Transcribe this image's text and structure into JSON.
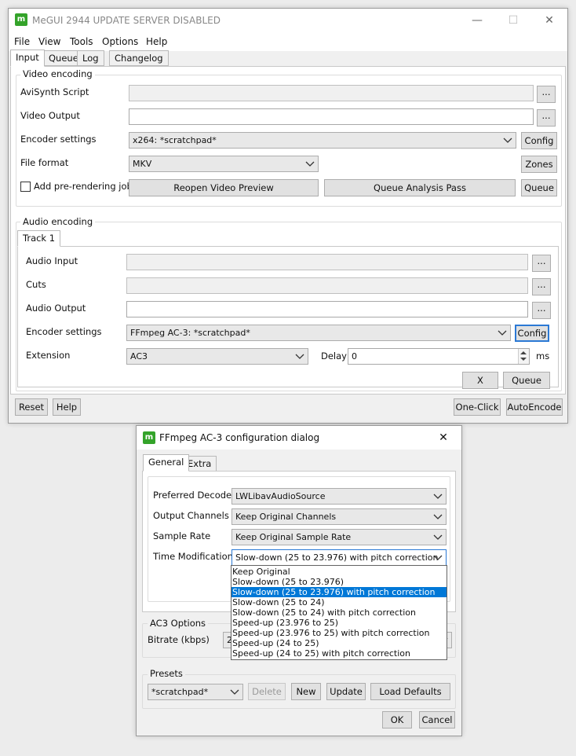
{
  "main_window": {
    "title": "MeGUI 2944 UPDATE SERVER DISABLED",
    "menu": [
      "File",
      "View",
      "Tools",
      "Options",
      "Help"
    ],
    "tabs": [
      "Input",
      "Queue",
      "Log",
      "Changelog"
    ],
    "video": {
      "group_label": "Video encoding",
      "avisynth_label": "AviSynth Script",
      "avisynth_value": "",
      "output_label": "Video Output",
      "output_value": "",
      "encoder_label": "Encoder settings",
      "encoder_value": "x264: *scratchpad*",
      "config_label": "Config",
      "format_label": "File format",
      "format_value": "MKV",
      "zones_label": "Zones",
      "prerender_label": "Add pre-rendering job",
      "reopen_label": "Reopen Video Preview",
      "analysis_label": "Queue Analysis Pass",
      "queue_label": "Queue",
      "browse_label": "..."
    },
    "audio": {
      "group_label": "Audio encoding",
      "track_tab": "Track 1",
      "input_label": "Audio Input",
      "cuts_label": "Cuts",
      "output_label": "Audio Output",
      "encoder_label": "Encoder settings",
      "encoder_value": "FFmpeg AC-3: *scratchpad*",
      "config_label": "Config",
      "extension_label": "Extension",
      "extension_value": "AC3",
      "delay_label": "Delay",
      "delay_value": "0",
      "ms_label": "ms",
      "x_label": "X",
      "queue_label": "Queue",
      "browse_label": "..."
    },
    "bottom": {
      "reset": "Reset",
      "help": "Help",
      "oneclick": "One-Click",
      "autoencode": "AutoEncode"
    }
  },
  "dialog": {
    "title": "FFmpeg AC-3 configuration dialog",
    "tabs": [
      "General",
      "Extra"
    ],
    "decoder_label": "Preferred Decoder",
    "decoder_value": "LWLibavAudioSource",
    "channels_label": "Output Channels",
    "channels_value": "Keep Original Channels",
    "rate_label": "Sample Rate",
    "rate_value": "Keep Original Sample Rate",
    "time_label": "Time Modification",
    "time_value": "Slow-down (25 to 23.976) with pitch correction",
    "time_options": [
      "Keep Original",
      "Slow-down (25 to 23.976)",
      "Slow-down (25 to 23.976) with pitch correction",
      "Slow-down (25 to 24)",
      "Slow-down (25 to 24) with pitch correction",
      "Speed-up (23.976 to 25)",
      "Speed-up (23.976 to 25) with pitch correction",
      "Speed-up (24 to 25)",
      "Speed-up (24 to 25) with pitch correction"
    ],
    "time_selected_index": 2,
    "ac3_group": "AC3 Options",
    "bitrate_label": "Bitrate (kbps)",
    "bitrate_value": "2",
    "presets_group": "Presets",
    "preset_value": "*scratchpad*",
    "delete_label": "Delete",
    "new_label": "New",
    "update_label": "Update",
    "load_defaults_label": "Load Defaults",
    "ok_label": "OK",
    "cancel_label": "Cancel"
  },
  "icons": {
    "app_icon": "megui-logo-icon",
    "minimize": "minimize-icon",
    "maximize": "maximize-icon",
    "close": "close-icon",
    "dropdown": "chevron-down-icon"
  }
}
